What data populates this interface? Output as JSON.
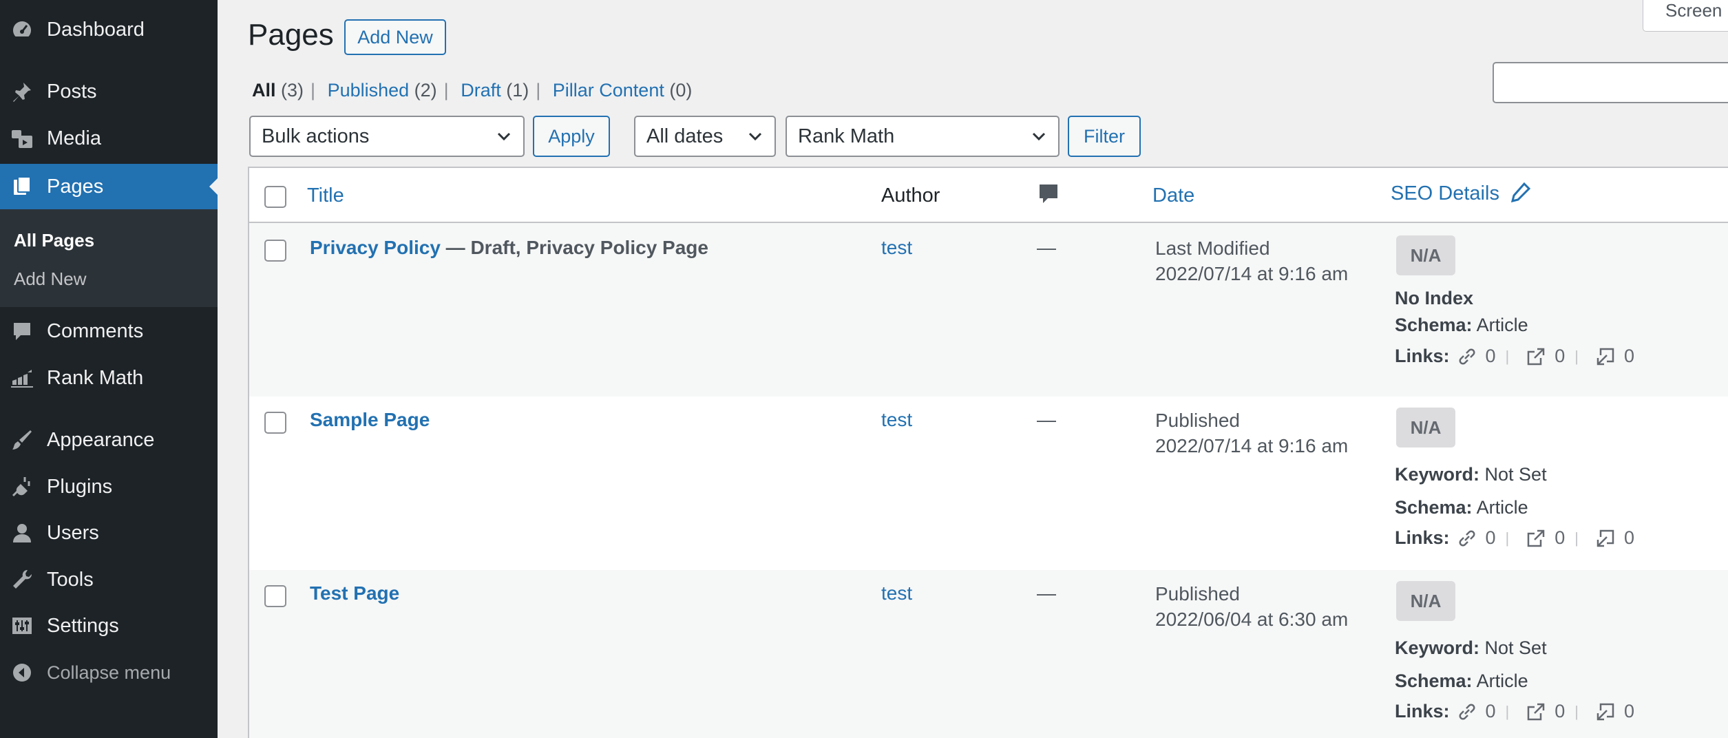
{
  "sidebar": {
    "items": [
      {
        "label": "Dashboard",
        "icon": "dashboard-icon"
      },
      {
        "label": "Posts",
        "icon": "pin-icon"
      },
      {
        "label": "Media",
        "icon": "media-icon"
      },
      {
        "label": "Pages",
        "icon": "pages-icon",
        "active": true
      },
      {
        "label": "Comments",
        "icon": "comment-icon"
      },
      {
        "label": "Rank Math",
        "icon": "rank-math-icon"
      },
      {
        "label": "Appearance",
        "icon": "brush-icon"
      },
      {
        "label": "Plugins",
        "icon": "plug-icon"
      },
      {
        "label": "Users",
        "icon": "user-icon"
      },
      {
        "label": "Tools",
        "icon": "wrench-icon"
      },
      {
        "label": "Settings",
        "icon": "settings-icon"
      }
    ],
    "submenu": {
      "all_pages": "All Pages",
      "add_new": "Add New"
    },
    "collapse": "Collapse menu"
  },
  "header": {
    "title": "Pages",
    "add_new": "Add New",
    "screen_options": "Screen"
  },
  "filters_nav": {
    "all": "All",
    "all_count": "(3)",
    "published": "Published",
    "published_count": "(2)",
    "draft": "Draft",
    "draft_count": "(1)",
    "pillar": "Pillar Content",
    "pillar_count": "(0)"
  },
  "toolbar": {
    "bulk_actions": "Bulk actions",
    "apply": "Apply",
    "dates": "All dates",
    "rank_math": "Rank Math",
    "filter": "Filter"
  },
  "table": {
    "columns": {
      "title": "Title",
      "author": "Author",
      "date": "Date",
      "seo": "SEO Details"
    },
    "rows": [
      {
        "title": "Privacy Policy",
        "state": " — Draft, Privacy Policy Page",
        "author": "test",
        "comments": "—",
        "date_status": "Last Modified",
        "date": "2022/07/14 at 9:16 am",
        "score": "N/A",
        "line1_label": "No Index",
        "line1_value": "",
        "schema_label": "Schema:",
        "schema": "Article",
        "links_label": "Links:",
        "internal": "0",
        "external": "0",
        "incoming": "0"
      },
      {
        "title": "Sample Page",
        "state": "",
        "author": "test",
        "comments": "—",
        "date_status": "Published",
        "date": "2022/07/14 at 9:16 am",
        "score": "N/A",
        "line1_label": "Keyword:",
        "line1_value": " Not Set",
        "schema_label": "Schema:",
        "schema": "Article",
        "links_label": "Links:",
        "internal": "0",
        "external": "0",
        "incoming": "0"
      },
      {
        "title": "Test Page",
        "state": "",
        "author": "test",
        "comments": "—",
        "date_status": "Published",
        "date": "2022/06/04 at 6:30 am",
        "score": "N/A",
        "line1_label": "Keyword:",
        "line1_value": " Not Set",
        "schema_label": "Schema:",
        "schema": "Article",
        "links_label": "Links:",
        "internal": "0",
        "external": "0",
        "incoming": "0"
      }
    ]
  },
  "colors": {
    "accent": "#2271b1",
    "sidebar": "#1d2327",
    "background": "#f0f0f1"
  }
}
